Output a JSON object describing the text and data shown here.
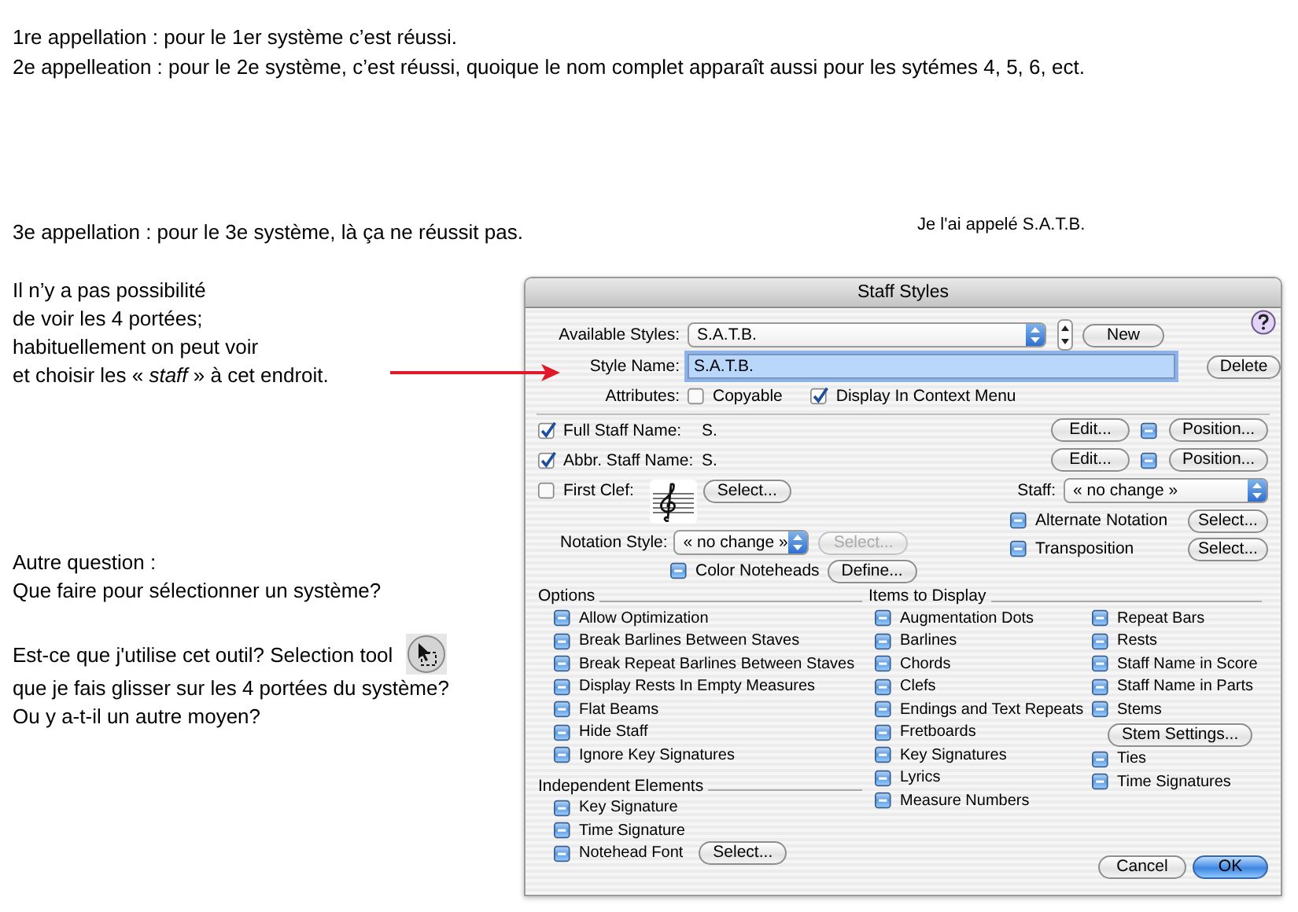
{
  "notes_top": [
    "1re appellation : pour le 1er système c’est réussi.",
    "2e appelleation : pour le 2e système, c’est réussi, quoique le nom complet apparaît aussi pour les sytémes 4, 5, 6, ect."
  ],
  "note_third": "3e appellation : pour le 3e système, là ça ne réussit pas.",
  "note_named": "Je l'ai appelé S.A.T.B.",
  "note_staff": [
    "Il n’y a pas possibilité",
    "de voir les 4 portées;",
    "habituellement on peut voir",
    "et choisir les « *staff* » à cet endroit."
  ],
  "question": [
    "Autre question :",
    "Que faire pour sélectionner un système?"
  ],
  "question_tool": {
    "line": "Est-ce que j'utilise cet outil? Selection tool",
    "continuation": [
      "que je fais glisser sur les 4 portées du système?",
      "Ou y a-t-il un autre moyen?"
    ]
  },
  "dialog": {
    "title": "Staff Styles",
    "available_styles": {
      "label": "Available Styles:",
      "value": "S.A.T.B.",
      "button": "New"
    },
    "style_name": {
      "label": "Style Name:",
      "value": "S.A.T.B.",
      "focused": true,
      "button": "Delete"
    },
    "attributes": {
      "label": "Attributes:",
      "options": [
        {
          "label": "Copyable",
          "checked": false
        },
        {
          "label": "Display In Context Menu",
          "checked": true
        }
      ]
    },
    "staff_names": [
      {
        "label": "Full Staff Name:",
        "value": "S.",
        "checked": true,
        "edit": "Edit...",
        "position_mixed": true,
        "position": "Position..."
      },
      {
        "label": "Abbr. Staff Name:",
        "value": "S.",
        "checked": true,
        "edit": "Edit...",
        "position_mixed": true,
        "position": "Position..."
      }
    ],
    "first_clef": {
      "label": "First Clef:",
      "checked": false,
      "button": "Select..."
    },
    "notation_style": {
      "label": "Notation Style:",
      "value": "« no change »",
      "button": "Select...",
      "button_disabled": true
    },
    "color_noteheads": {
      "label": "Color Noteheads",
      "mixed": true,
      "button": "Define..."
    },
    "staff": {
      "label": "Staff:",
      "value": "« no change »"
    },
    "staff_options": [
      {
        "label": "Alternate Notation",
        "mixed": true,
        "button": "Select..."
      },
      {
        "label": "Transposition",
        "mixed": true,
        "button": "Select..."
      }
    ],
    "options": {
      "title": "Options",
      "items": [
        {
          "label": "Allow Optimization",
          "mixed": true
        },
        {
          "label": "Break Barlines Between Staves",
          "mixed": true
        },
        {
          "label": "Break Repeat Barlines Between Staves",
          "mixed": true
        },
        {
          "label": "Display Rests In Empty Measures",
          "mixed": true
        },
        {
          "label": "Flat Beams",
          "mixed": true
        },
        {
          "label": "Hide Staff",
          "mixed": true
        },
        {
          "label": "Ignore Key Signatures",
          "mixed": true
        }
      ]
    },
    "independent": {
      "title": "Independent Elements",
      "items": [
        {
          "label": "Key Signature",
          "mixed": true
        },
        {
          "label": "Time Signature",
          "mixed": true
        },
        {
          "label": "Notehead Font",
          "mixed": true,
          "button": "Select..."
        }
      ]
    },
    "items_to_display": {
      "title": "Items to Display",
      "columns": [
        [
          {
            "label": "Augmentation Dots",
            "mixed": true
          },
          {
            "label": "Barlines",
            "mixed": true
          },
          {
            "label": "Chords",
            "mixed": true
          },
          {
            "label": "Clefs",
            "mixed": true
          },
          {
            "label": "Endings and Text Repeats",
            "mixed": true
          },
          {
            "label": "Fretboards",
            "mixed": true
          },
          {
            "label": "Key Signatures",
            "mixed": true
          },
          {
            "label": "Lyrics",
            "mixed": true
          },
          {
            "label": "Measure Numbers",
            "mixed": true
          }
        ],
        [
          {
            "label": "Repeat Bars",
            "mixed": true
          },
          {
            "label": "Rests",
            "mixed": true
          },
          {
            "label": "Staff Name in Score",
            "mixed": true
          },
          {
            "label": "Staff Name in Parts",
            "mixed": true
          },
          {
            "label": "Stems",
            "mixed": true,
            "button": "Stem Settings..."
          },
          {
            "label": "Ties",
            "mixed": true
          },
          {
            "label": "Time Signatures",
            "mixed": true
          }
        ]
      ]
    },
    "footer_buttons": [
      {
        "label": "Cancel",
        "default": false
      },
      {
        "label": "OK",
        "default": true
      }
    ]
  }
}
